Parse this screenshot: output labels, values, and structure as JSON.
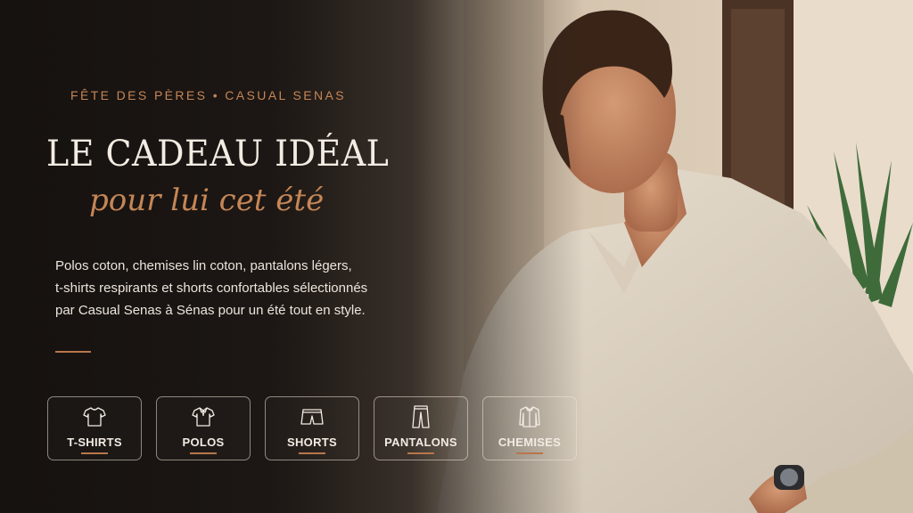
{
  "hero": {
    "eyebrow": "FÊTE DES PÈRES • CASUAL SENAS",
    "headline": "LE CADEAU IDÉAL",
    "script_line": "pour lui cet été",
    "body_lines": [
      "Polos coton, chemises lin coton, pantalons légers,",
      "t-shirts respirants et shorts confortables sélectionnés",
      "par Casual Senas à Sénas pour un été tout en style."
    ]
  },
  "categories": [
    {
      "label": "T-SHIRTS",
      "icon": "t-shirt-icon"
    },
    {
      "label": "POLOS",
      "icon": "polo-icon"
    },
    {
      "label": "SHORTS",
      "icon": "shorts-icon"
    },
    {
      "label": "PANTALONS",
      "icon": "pants-icon"
    },
    {
      "label": "CHEMISES",
      "icon": "shirt-icon"
    }
  ],
  "colors": {
    "accent": "#c58656",
    "background": "#1c1714",
    "text": "#f3ece3"
  }
}
